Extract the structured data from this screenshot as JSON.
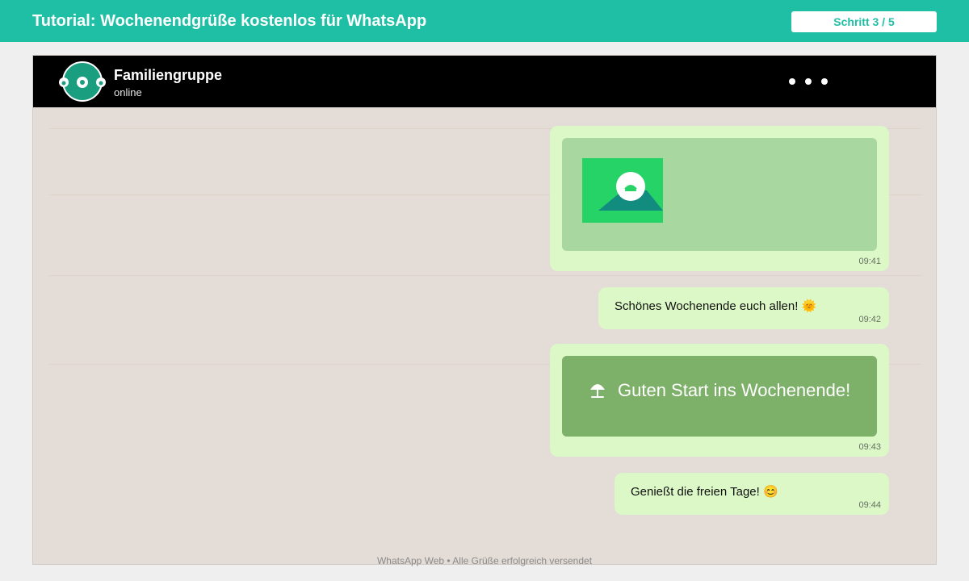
{
  "tutorial": {
    "title": "Tutorial: Wochenendgrüße kostenlos für WhatsApp",
    "step": "Schritt 3 / 5"
  },
  "chat": {
    "name": "Familiengruppe",
    "status": "online",
    "menu_icon": "more-dots-icon"
  },
  "messages": [
    {
      "type": "image",
      "time": "09:41",
      "icon": "image-icon"
    },
    {
      "type": "text",
      "text": "Schönes Wochenende euch allen! 🌞",
      "time": "09:42"
    },
    {
      "type": "banner",
      "text": "Guten Start ins Wochenende!",
      "time": "09:43",
      "icon": "beach-umbrella-icon"
    },
    {
      "type": "text",
      "text": "Genießt die freien Tage! 😊",
      "time": "09:44"
    }
  ],
  "footer": "WhatsApp Web • Alle Grüße erfolgreich versendet",
  "colors": {
    "brand": "#1fbfa5",
    "bubble": "#dcf8c6",
    "header": "#000000",
    "wallpaper": "#e4dcd6",
    "whatsapp_green": "#25d366",
    "banner": "#7db068"
  }
}
